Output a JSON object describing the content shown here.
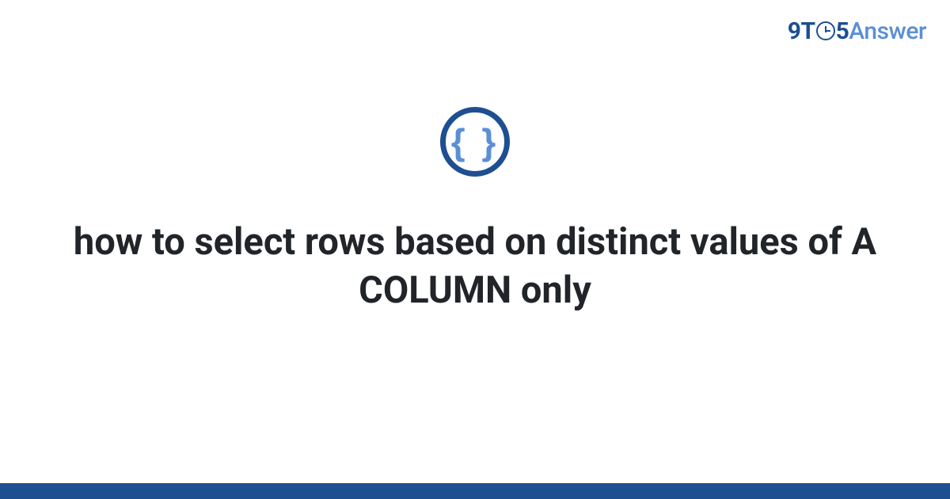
{
  "logo": {
    "part1": "9T",
    "part2": "5",
    "part3": "Answer"
  },
  "icon": {
    "braces": "{ }"
  },
  "title": "how to select rows based on distinct values of A COLUMN only"
}
